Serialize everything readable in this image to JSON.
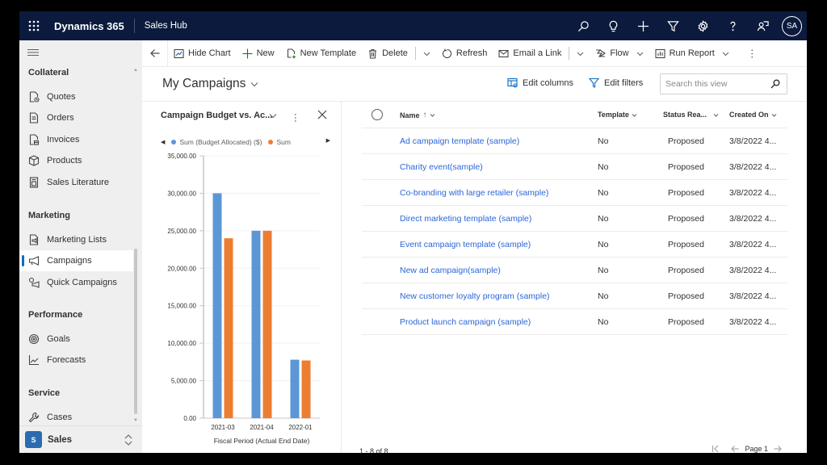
{
  "topbar": {
    "app_name": "Dynamics 365",
    "hub_name": "Sales Hub",
    "avatar_initials": "SA",
    "icons": [
      "search-icon",
      "lightbulb-icon",
      "plus-icon",
      "filter-icon",
      "gear-icon",
      "help-icon",
      "feedback-icon"
    ]
  },
  "sidebar": {
    "groups": [
      {
        "title": "Collateral",
        "items": [
          {
            "label": "Quotes",
            "icon": "quote-icon"
          },
          {
            "label": "Orders",
            "icon": "order-icon"
          },
          {
            "label": "Invoices",
            "icon": "invoice-icon"
          },
          {
            "label": "Products",
            "icon": "product-box-icon"
          },
          {
            "label": "Sales Literature",
            "icon": "literature-icon"
          }
        ]
      },
      {
        "title": "Marketing",
        "items": [
          {
            "label": "Marketing Lists",
            "icon": "marketing-list-icon"
          },
          {
            "label": "Campaigns",
            "icon": "megaphone-icon",
            "active": true
          },
          {
            "label": "Quick Campaigns",
            "icon": "quick-campaign-icon"
          }
        ]
      },
      {
        "title": "Performance",
        "items": [
          {
            "label": "Goals",
            "icon": "target-icon"
          },
          {
            "label": "Forecasts",
            "icon": "line-chart-icon"
          }
        ]
      },
      {
        "title": "Service",
        "items": [
          {
            "label": "Cases",
            "icon": "wrench-icon"
          }
        ]
      }
    ],
    "area": {
      "badge": "S",
      "label": "Sales"
    }
  },
  "commandbar": {
    "hide_chart": "Hide Chart",
    "new": "New",
    "new_template": "New Template",
    "delete": "Delete",
    "refresh": "Refresh",
    "email_link": "Email a Link",
    "flow": "Flow",
    "run_report": "Run Report"
  },
  "view": {
    "title": "My Campaigns",
    "edit_columns": "Edit columns",
    "edit_filters": "Edit filters",
    "search_placeholder": "Search this view"
  },
  "chart_panel": {
    "title": "Campaign Budget vs. Ac...",
    "legend": [
      {
        "label": "Sum (Budget Allocated) ($)",
        "color": "#5b97d6"
      },
      {
        "label": "Sum",
        "color": "#ed7d31"
      }
    ]
  },
  "chart_data": {
    "type": "bar",
    "title": "Campaign Budget vs. Ac...",
    "xlabel": "Fiscal Period (Actual End Date)",
    "ylabel": "",
    "categories": [
      "2021-03",
      "2021-04",
      "2022-01"
    ],
    "series": [
      {
        "name": "Sum (Budget Allocated) ($)",
        "color": "#5b97d6",
        "values": [
          30000,
          25000,
          7800
        ]
      },
      {
        "name": "Sum",
        "color": "#ed7d31",
        "values": [
          24000,
          25000,
          7700
        ]
      }
    ],
    "ylim": [
      0,
      35000
    ],
    "yticks": [
      0,
      5000,
      10000,
      15000,
      20000,
      25000,
      30000,
      35000
    ],
    "ytick_labels": [
      "0.00",
      "5,000.00",
      "10,000.00",
      "15,000.00",
      "20,000.00",
      "25,000.00",
      "30,000.00",
      "35,000.00"
    ],
    "grid": true,
    "legend_position": "top"
  },
  "grid": {
    "columns": [
      {
        "label": "Name",
        "sorted": "ascending"
      },
      {
        "label": "Template"
      },
      {
        "label": "Status Rea..."
      },
      {
        "label": "Created On"
      }
    ],
    "rows": [
      {
        "name": "Ad campaign template (sample)",
        "template": "No",
        "status": "Proposed",
        "created": "3/8/2022 4..."
      },
      {
        "name": "Charity event(sample)",
        "template": "No",
        "status": "Proposed",
        "created": "3/8/2022 4..."
      },
      {
        "name": "Co-branding with large retailer (sample)",
        "template": "No",
        "status": "Proposed",
        "created": "3/8/2022 4..."
      },
      {
        "name": "Direct marketing template (sample)",
        "template": "No",
        "status": "Proposed",
        "created": "3/8/2022 4..."
      },
      {
        "name": "Event campaign template (sample)",
        "template": "No",
        "status": "Proposed",
        "created": "3/8/2022 4..."
      },
      {
        "name": "New ad campaign(sample)",
        "template": "No",
        "status": "Proposed",
        "created": "3/8/2022 4..."
      },
      {
        "name": "New customer loyalty program (sample)",
        "template": "No",
        "status": "Proposed",
        "created": "3/8/2022 4..."
      },
      {
        "name": "Product launch campaign (sample)",
        "template": "No",
        "status": "Proposed",
        "created": "3/8/2022 4..."
      }
    ],
    "record_count": "1 - 8 of 8",
    "page_label": "Page 1"
  }
}
